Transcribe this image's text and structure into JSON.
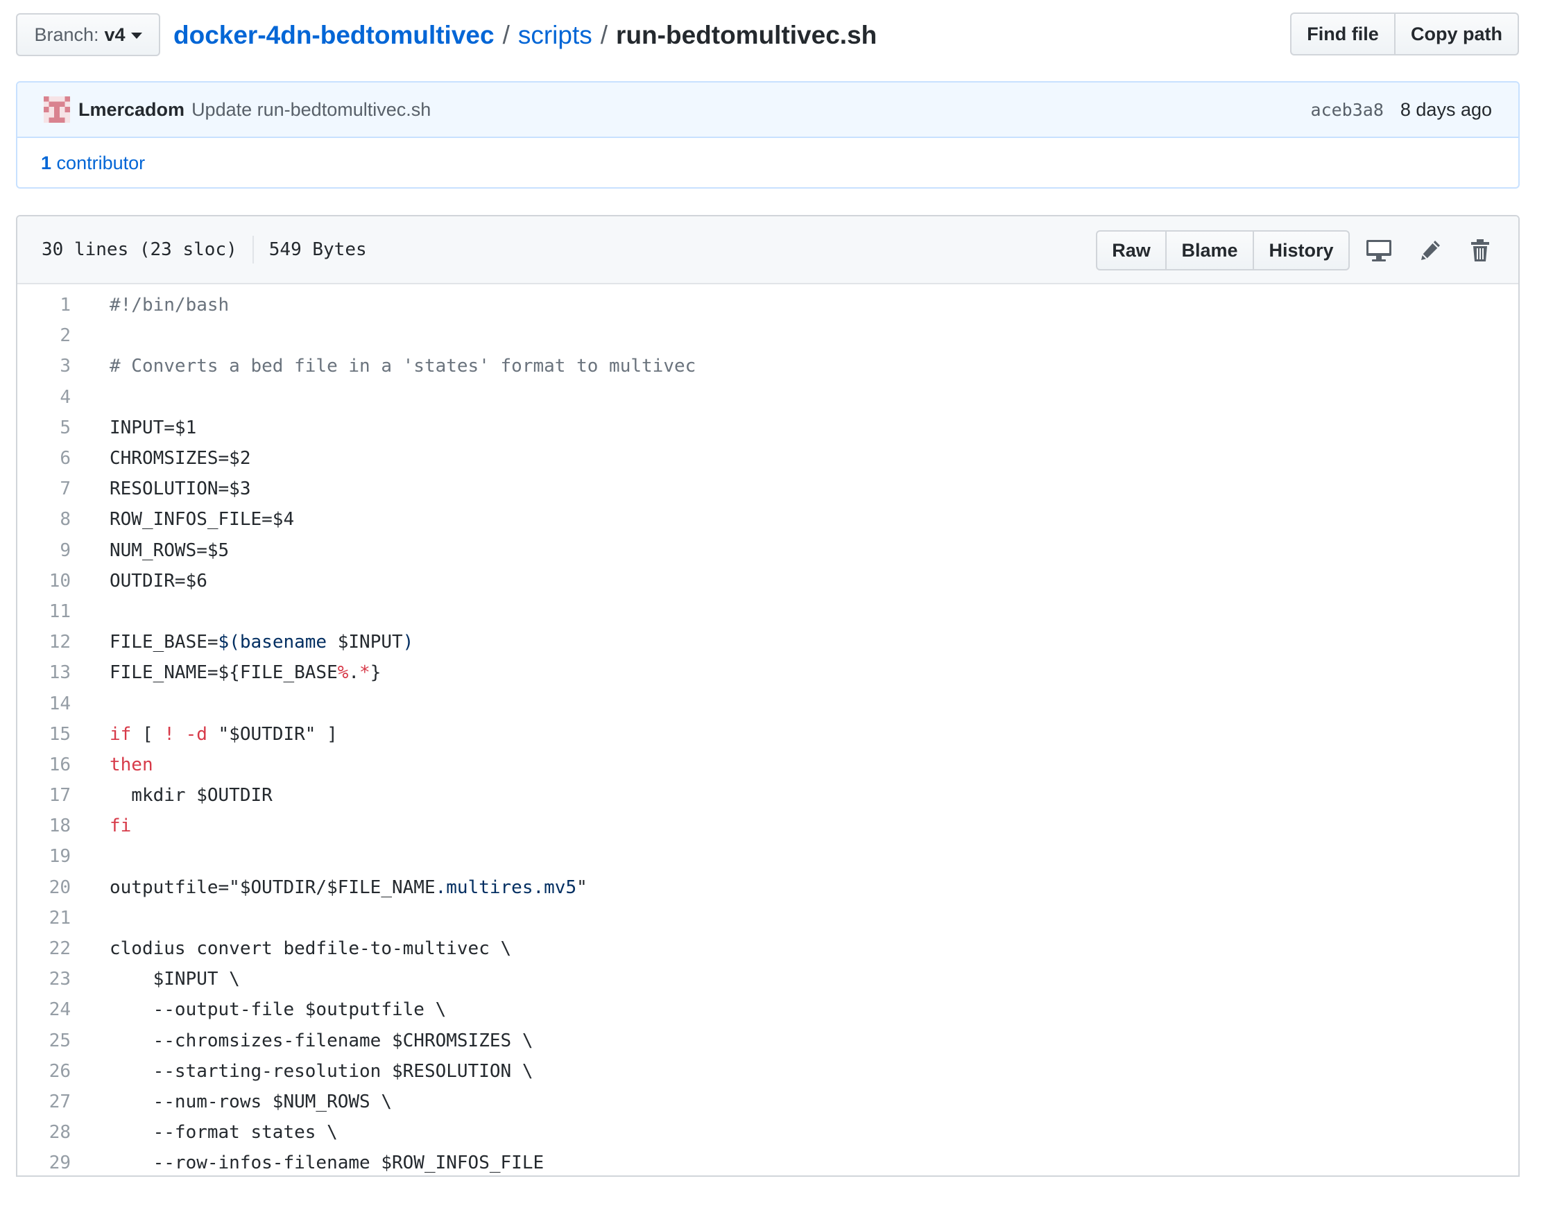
{
  "branch": {
    "label": "Branch:",
    "value": "v4"
  },
  "breadcrumb": {
    "repo": "docker-4dn-bedtomultivec",
    "dir": "scripts",
    "file": "run-bedtomultivec.sh",
    "sep": "/"
  },
  "file_nav": {
    "find_file": "Find file",
    "copy_path": "Copy path"
  },
  "commit": {
    "author": "Lmercadom",
    "message": "Update run-bedtomultivec.sh",
    "sha": "aceb3a8",
    "age": "8 days ago",
    "contributors_count": "1",
    "contributors_label": "contributor"
  },
  "file_info": {
    "lines": "30 lines (23 sloc)",
    "size": "549 Bytes"
  },
  "file_actions": {
    "raw": "Raw",
    "blame": "Blame",
    "history": "History"
  },
  "icons": {
    "avatar": "identicon-avatar",
    "desktop": "desktop-icon",
    "edit": "pencil-icon",
    "delete": "trash-icon"
  },
  "colors": {
    "link": "#0366d6",
    "keyword": "#d73a49",
    "comment": "#6a737d",
    "builtin": "#032f62",
    "line_number": "#959da5"
  },
  "code_lines": [
    [
      {
        "t": "c",
        "s": "#!/bin/bash"
      }
    ],
    [],
    [
      {
        "t": "c",
        "s": "# Converts a bed file in a 'states' format to multivec"
      }
    ],
    [],
    [
      {
        "t": "n",
        "s": "INPUT=$1"
      }
    ],
    [
      {
        "t": "n",
        "s": "CHROMSIZES=$2"
      }
    ],
    [
      {
        "t": "n",
        "s": "RESOLUTION=$3"
      }
    ],
    [
      {
        "t": "n",
        "s": "ROW_INFOS_FILE=$4"
      }
    ],
    [
      {
        "t": "n",
        "s": "NUM_ROWS=$5"
      }
    ],
    [
      {
        "t": "n",
        "s": "OUTDIR=$6"
      }
    ],
    [],
    [
      {
        "t": "n",
        "s": "FILE_BASE="
      },
      {
        "t": "b",
        "s": "$(basename"
      },
      {
        "t": "n",
        "s": " $INPUT"
      },
      {
        "t": "b",
        "s": ")"
      }
    ],
    [
      {
        "t": "n",
        "s": "FILE_NAME=${FILE_BASE"
      },
      {
        "t": "k",
        "s": "%"
      },
      {
        "t": "n",
        "s": "."
      },
      {
        "t": "k",
        "s": "*"
      },
      {
        "t": "n",
        "s": "}"
      }
    ],
    [],
    [
      {
        "t": "k",
        "s": "if"
      },
      {
        "t": "n",
        "s": " [ "
      },
      {
        "t": "k",
        "s": "!"
      },
      {
        "t": "n",
        "s": " "
      },
      {
        "t": "k",
        "s": "-d"
      },
      {
        "t": "n",
        "s": " \"$OUTDIR\" ]"
      }
    ],
    [
      {
        "t": "k",
        "s": "then"
      }
    ],
    [
      {
        "t": "n",
        "s": "  mkdir $OUTDIR"
      }
    ],
    [
      {
        "t": "k",
        "s": "fi"
      }
    ],
    [],
    [
      {
        "t": "n",
        "s": "outputfile=\"$OUTDIR/$FILE_NAME"
      },
      {
        "t": "b",
        "s": ".multires.mv5"
      },
      {
        "t": "n",
        "s": "\""
      }
    ],
    [],
    [
      {
        "t": "n",
        "s": "clodius convert bedfile-to-multivec \\"
      }
    ],
    [
      {
        "t": "n",
        "s": "    $INPUT \\"
      }
    ],
    [
      {
        "t": "n",
        "s": "    --output-file $outputfile \\"
      }
    ],
    [
      {
        "t": "n",
        "s": "    --chromsizes-filename $CHROMSIZES \\"
      }
    ],
    [
      {
        "t": "n",
        "s": "    --starting-resolution $RESOLUTION \\"
      }
    ],
    [
      {
        "t": "n",
        "s": "    --num-rows $NUM_ROWS \\"
      }
    ],
    [
      {
        "t": "n",
        "s": "    --format states \\"
      }
    ],
    [
      {
        "t": "n",
        "s": "    --row-infos-filename $ROW_INFOS_FILE"
      }
    ]
  ]
}
